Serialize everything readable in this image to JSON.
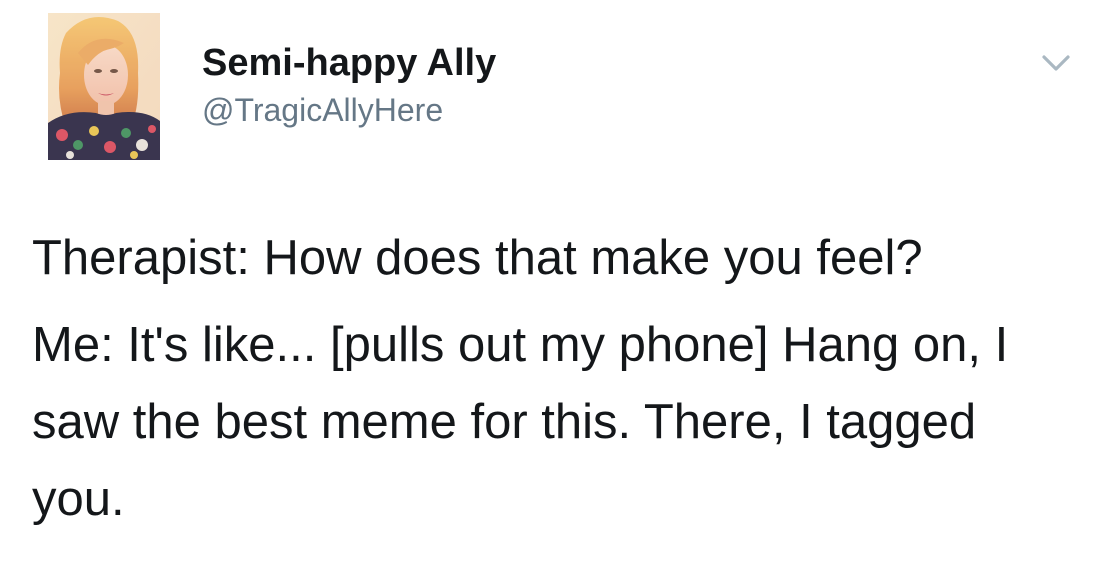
{
  "tweet": {
    "author": {
      "display_name": "Semi-happy Ally",
      "handle": "@TragicAllyHere"
    },
    "text_lines": [
      "Therapist: How does that make you feel?",
      "Me: It's like... [pulls out my phone] Hang on, I saw the best meme for this. There, I tagged you."
    ]
  },
  "icons": {
    "menu": "chevron-down-icon"
  },
  "colors": {
    "name": "#14171a",
    "handle": "#657786",
    "chevron": "#aab8c2"
  }
}
